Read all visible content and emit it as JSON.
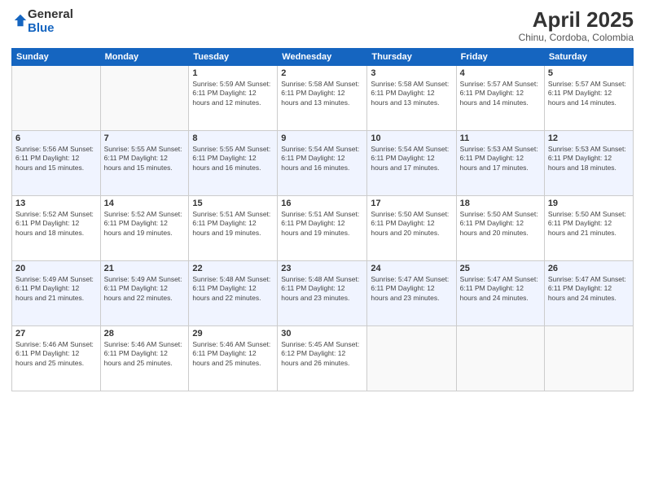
{
  "logo": {
    "general": "General",
    "blue": "Blue"
  },
  "header": {
    "month": "April 2025",
    "location": "Chinu, Cordoba, Colombia"
  },
  "weekdays": [
    "Sunday",
    "Monday",
    "Tuesday",
    "Wednesday",
    "Thursday",
    "Friday",
    "Saturday"
  ],
  "weeks": [
    [
      {
        "num": "",
        "info": ""
      },
      {
        "num": "",
        "info": ""
      },
      {
        "num": "1",
        "info": "Sunrise: 5:59 AM\nSunset: 6:11 PM\nDaylight: 12 hours and 12 minutes."
      },
      {
        "num": "2",
        "info": "Sunrise: 5:58 AM\nSunset: 6:11 PM\nDaylight: 12 hours and 13 minutes."
      },
      {
        "num": "3",
        "info": "Sunrise: 5:58 AM\nSunset: 6:11 PM\nDaylight: 12 hours and 13 minutes."
      },
      {
        "num": "4",
        "info": "Sunrise: 5:57 AM\nSunset: 6:11 PM\nDaylight: 12 hours and 14 minutes."
      },
      {
        "num": "5",
        "info": "Sunrise: 5:57 AM\nSunset: 6:11 PM\nDaylight: 12 hours and 14 minutes."
      }
    ],
    [
      {
        "num": "6",
        "info": "Sunrise: 5:56 AM\nSunset: 6:11 PM\nDaylight: 12 hours and 15 minutes."
      },
      {
        "num": "7",
        "info": "Sunrise: 5:55 AM\nSunset: 6:11 PM\nDaylight: 12 hours and 15 minutes."
      },
      {
        "num": "8",
        "info": "Sunrise: 5:55 AM\nSunset: 6:11 PM\nDaylight: 12 hours and 16 minutes."
      },
      {
        "num": "9",
        "info": "Sunrise: 5:54 AM\nSunset: 6:11 PM\nDaylight: 12 hours and 16 minutes."
      },
      {
        "num": "10",
        "info": "Sunrise: 5:54 AM\nSunset: 6:11 PM\nDaylight: 12 hours and 17 minutes."
      },
      {
        "num": "11",
        "info": "Sunrise: 5:53 AM\nSunset: 6:11 PM\nDaylight: 12 hours and 17 minutes."
      },
      {
        "num": "12",
        "info": "Sunrise: 5:53 AM\nSunset: 6:11 PM\nDaylight: 12 hours and 18 minutes."
      }
    ],
    [
      {
        "num": "13",
        "info": "Sunrise: 5:52 AM\nSunset: 6:11 PM\nDaylight: 12 hours and 18 minutes."
      },
      {
        "num": "14",
        "info": "Sunrise: 5:52 AM\nSunset: 6:11 PM\nDaylight: 12 hours and 19 minutes."
      },
      {
        "num": "15",
        "info": "Sunrise: 5:51 AM\nSunset: 6:11 PM\nDaylight: 12 hours and 19 minutes."
      },
      {
        "num": "16",
        "info": "Sunrise: 5:51 AM\nSunset: 6:11 PM\nDaylight: 12 hours and 19 minutes."
      },
      {
        "num": "17",
        "info": "Sunrise: 5:50 AM\nSunset: 6:11 PM\nDaylight: 12 hours and 20 minutes."
      },
      {
        "num": "18",
        "info": "Sunrise: 5:50 AM\nSunset: 6:11 PM\nDaylight: 12 hours and 20 minutes."
      },
      {
        "num": "19",
        "info": "Sunrise: 5:50 AM\nSunset: 6:11 PM\nDaylight: 12 hours and 21 minutes."
      }
    ],
    [
      {
        "num": "20",
        "info": "Sunrise: 5:49 AM\nSunset: 6:11 PM\nDaylight: 12 hours and 21 minutes."
      },
      {
        "num": "21",
        "info": "Sunrise: 5:49 AM\nSunset: 6:11 PM\nDaylight: 12 hours and 22 minutes."
      },
      {
        "num": "22",
        "info": "Sunrise: 5:48 AM\nSunset: 6:11 PM\nDaylight: 12 hours and 22 minutes."
      },
      {
        "num": "23",
        "info": "Sunrise: 5:48 AM\nSunset: 6:11 PM\nDaylight: 12 hours and 23 minutes."
      },
      {
        "num": "24",
        "info": "Sunrise: 5:47 AM\nSunset: 6:11 PM\nDaylight: 12 hours and 23 minutes."
      },
      {
        "num": "25",
        "info": "Sunrise: 5:47 AM\nSunset: 6:11 PM\nDaylight: 12 hours and 24 minutes."
      },
      {
        "num": "26",
        "info": "Sunrise: 5:47 AM\nSunset: 6:11 PM\nDaylight: 12 hours and 24 minutes."
      }
    ],
    [
      {
        "num": "27",
        "info": "Sunrise: 5:46 AM\nSunset: 6:11 PM\nDaylight: 12 hours and 25 minutes."
      },
      {
        "num": "28",
        "info": "Sunrise: 5:46 AM\nSunset: 6:11 PM\nDaylight: 12 hours and 25 minutes."
      },
      {
        "num": "29",
        "info": "Sunrise: 5:46 AM\nSunset: 6:11 PM\nDaylight: 12 hours and 25 minutes."
      },
      {
        "num": "30",
        "info": "Sunrise: 5:45 AM\nSunset: 6:12 PM\nDaylight: 12 hours and 26 minutes."
      },
      {
        "num": "",
        "info": ""
      },
      {
        "num": "",
        "info": ""
      },
      {
        "num": "",
        "info": ""
      }
    ]
  ]
}
